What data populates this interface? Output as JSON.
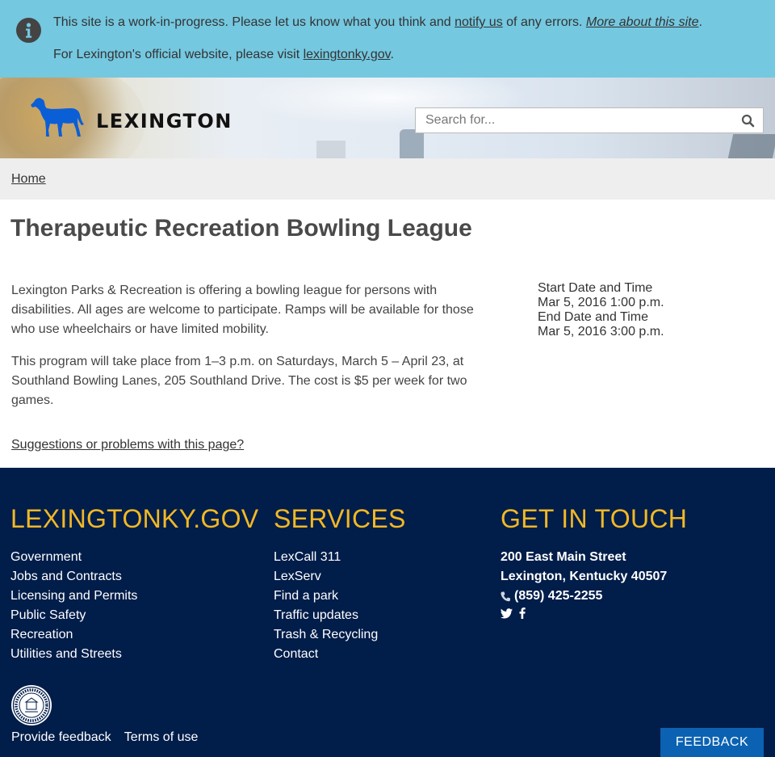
{
  "notice": {
    "line1_before": "This site is a work-in-progress. Please let us know what you think and ",
    "notify_link": "notify us",
    "line1_middle": " of any errors. ",
    "more_link": "More about this site",
    "line1_after": ".",
    "line2_before": "For Lexington's official website, please visit ",
    "official_link": "lexingtonky.gov",
    "line2_after": ".",
    "icon": "info-circle-icon",
    "background": "#74c8e0"
  },
  "header": {
    "logo_text": "LEXINGTON",
    "logo_icon": "horse-icon",
    "logo_color": "#0b5fd6",
    "search_placeholder": "Search for...",
    "search_icon": "magnifier-icon"
  },
  "breadcrumb": {
    "home": "Home"
  },
  "main": {
    "title": "Therapeutic Recreation Bowling League",
    "paragraphs": [
      "Lexington Parks & Recreation is offering a bowling league for persons with disabilities. All ages are welcome to participate. Ramps will be available for those who use wheelchairs or have limited mobility.",
      "This program will take place from 1–3 p.m. on Saturdays, March 5 – April 23, at Southland Bowling Lanes, 205 Southland Drive. The cost is $5 per week for two games."
    ],
    "start_label": "Start Date and Time",
    "start_value": "Mar 5, 2016 1:00 p.m.",
    "end_label": "End Date and Time",
    "end_value": "Mar 5, 2016 3:00 p.m.",
    "suggestions_link": "Suggestions or problems with this page?"
  },
  "footer": {
    "background": "#011d4a",
    "heading_color": "#f2b824",
    "col1_title": "LEXINGTONKY.GOV",
    "col1_links": [
      "Government",
      "Jobs and Contracts",
      "Licensing and Permits",
      "Public Safety",
      "Recreation",
      "Utilities and Streets"
    ],
    "col2_title": "SERVICES",
    "col2_links": [
      "LexCall 311",
      "LexServ",
      "Find a park",
      "Traffic updates",
      "Trash & Recycling",
      "Contact"
    ],
    "col3_title": "GET IN TOUCH",
    "address_line1": "200 East Main Street",
    "address_line2": "Lexington, Kentucky 40507",
    "phone": "(859) 425-2255",
    "social_icons": [
      "twitter-icon",
      "facebook-icon"
    ],
    "seal_icon": "city-seal-icon",
    "provide_feedback": "Provide feedback",
    "terms": "Terms of use",
    "feedback_button": "FEEDBACK",
    "feedback_button_color": "#0b62b2"
  }
}
